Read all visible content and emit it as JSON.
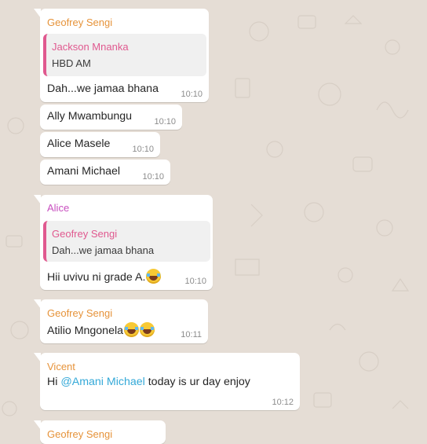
{
  "messages": [
    {
      "sender": "Geofrey Sengi",
      "sender_color": "#e6933a",
      "quote": {
        "name": "Jackson Mnanka",
        "text": "HBD AM"
      },
      "text": "Dah...we jamaa bhana",
      "time": "10:10"
    },
    {
      "text": "Ally Mwambungu",
      "time": "10:10"
    },
    {
      "text": "Alice Masele",
      "time": "10:10"
    },
    {
      "text": "Amani Michael",
      "time": "10:10"
    },
    {
      "sender": "Alice",
      "sender_color": "#c84fbf",
      "quote": {
        "name": "Geofrey Sengi",
        "text": "Dah...we jamaa bhana"
      },
      "text": "Hii uvivu ni grade A.",
      "emoji": "laughing-tears-emoji",
      "time": "10:10"
    },
    {
      "sender": "Geofrey Sengi",
      "sender_color": "#e6933a",
      "text": "Atilio Mngonela",
      "emoji": "laughing-tears-emoji",
      "time": "10:11"
    },
    {
      "sender": "Vicent",
      "sender_color": "#e6933a",
      "text_prefix": "Hi ",
      "mention": "@Amani Michael",
      "text_suffix": " today is ur day enjoy",
      "time": "10:12"
    },
    {
      "sender": "Geofrey Sengi",
      "sender_color": "#e6933a"
    }
  ],
  "colors": {
    "mention": "#34a9d8",
    "quote_accent": "#e0598f",
    "background": "#e5ddd5"
  }
}
